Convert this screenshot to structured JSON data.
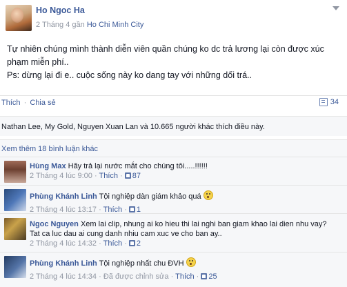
{
  "post": {
    "author": "Ho Ngoc Ha",
    "date": "2 Tháng 4",
    "near": "gần",
    "place": "Ho Chi Minh City",
    "text_line1": "Tự nhiên chúng mình thành diễn viên quần chúng ko dc trả lương lại còn được xúc",
    "text_line2": "phạm miễn phí..",
    "text_line3": "Ps: dừng lại đi e.. cuộc sống này ko dang tay với những dối trá.."
  },
  "actions": {
    "like": "Thích",
    "separator": "·",
    "share": "Chia sẻ",
    "comment_count": "34"
  },
  "likes": {
    "text": "Nathan Lee, My Gold, Nguyen Xuan Lan và 10.665 người khác thích điều này."
  },
  "view_more": "Xem thêm 18 bình luận khác",
  "comments": [
    {
      "name": "Hùng Max",
      "text": "Hãy trả lại nước mắt cho chúng tôi.....!!!!!!",
      "time": "2 Tháng 4 lúc 9:00",
      "like_label": "Thích",
      "likes": "87"
    },
    {
      "name": "Phùng Khánh Linh",
      "text": "Tội nghiệp dàn giám khảo quá",
      "time": "2 Tháng 4 lúc 13:17",
      "like_label": "Thích",
      "likes": "1"
    },
    {
      "name": "Ngoc Nguyen",
      "text": "Xem lai clip, nhung ai ko hieu thi lai nghi ban giam khao lai dien nhu vay?",
      "text2": "Tat ca luc dau ai cung danh nhiu cam xuc ve cho ban ay..",
      "time": "2 Tháng 4 lúc 14:32",
      "like_label": "Thích",
      "likes": "2"
    },
    {
      "name": "Phùng Khánh Linh",
      "text": "Tội nghiệp nhất chu ĐVH",
      "time": "2 Tháng 4 lúc 14:34",
      "edited": "Đã được chỉnh sửa",
      "like_label": "Thích",
      "likes": "25"
    }
  ]
}
